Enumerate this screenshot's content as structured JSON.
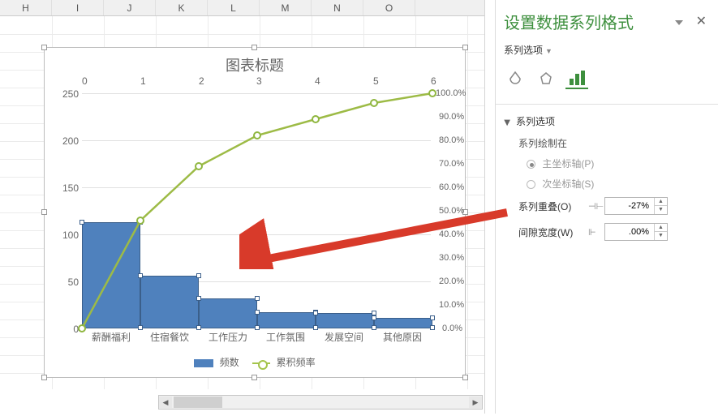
{
  "columns": [
    "H",
    "I",
    "J",
    "K",
    "L",
    "M",
    "N",
    "O"
  ],
  "chart": {
    "title": "图表标题",
    "top_axis": [
      "0",
      "1",
      "2",
      "3",
      "4",
      "5",
      "6"
    ],
    "y_left_ticks": [
      "250",
      "200",
      "150",
      "100",
      "50",
      "0"
    ],
    "y_right_ticks": [
      "100.0%",
      "90.0%",
      "80.0%",
      "70.0%",
      "60.0%",
      "50.0%",
      "40.0%",
      "30.0%",
      "20.0%",
      "10.0%",
      "0.0%"
    ],
    "x_categories": [
      "薪酬福利",
      "住宿餐饮",
      "工作压力",
      "工作氛围",
      "发展空间",
      "其他原因"
    ],
    "legend_bar": "频数",
    "legend_line": "累积频率"
  },
  "chart_data": {
    "type": "bar",
    "categories": [
      "薪酬福利",
      "住宿餐饮",
      "工作压力",
      "工作氛围",
      "发展空间",
      "其他原因"
    ],
    "series": [
      {
        "name": "频数",
        "type": "bar",
        "axis": "left",
        "values": [
          113,
          56,
          32,
          17,
          16,
          11
        ]
      },
      {
        "name": "累积频率",
        "type": "line",
        "axis": "right",
        "values": [
          46.0,
          69.0,
          82.0,
          89.0,
          96.0,
          100.0
        ],
        "unit": "%"
      }
    ],
    "y_left": {
      "min": 0,
      "max": 250,
      "label": ""
    },
    "y_right": {
      "min": 0,
      "max": 100,
      "label": "%"
    },
    "top_axis_values": [
      0,
      1,
      2,
      3,
      4,
      5,
      6
    ],
    "title": "图表标题"
  },
  "pane": {
    "title": "设置数据系列格式",
    "series_options": "系列选项",
    "section_series_options": "系列选项",
    "plot_on": "系列绘制在",
    "primary_axis": "主坐标轴(P)",
    "secondary_axis": "次坐标轴(S)",
    "overlap_label": "系列重叠(O)",
    "overlap_value": "-27%",
    "gap_label": "间隙宽度(W)",
    "gap_value": ".00%"
  }
}
